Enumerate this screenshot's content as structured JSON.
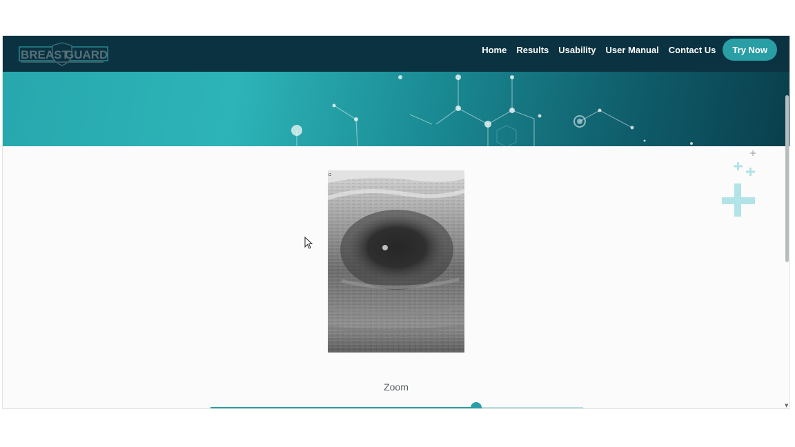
{
  "brand": {
    "logo_text_left": "BREAST",
    "logo_text_right": "GUARD",
    "logo_icon": "shield-logo-icon"
  },
  "nav": {
    "items": [
      {
        "label": "Home"
      },
      {
        "label": "Results"
      },
      {
        "label": "Usability"
      },
      {
        "label": "User Manual"
      },
      {
        "label": "Contact Us"
      }
    ],
    "cta_label": "Try Now"
  },
  "main": {
    "image_icon": "ultrasound-scan-image",
    "zoom_label": "Zoom",
    "zoom_level": 0.713
  },
  "icons": {
    "cursor": "mouse-pointer-icon",
    "decoration": "medical-cross-icon"
  },
  "colors": {
    "navbar": "#0b3240",
    "accent": "#2a9ea5",
    "hero_start": "#27a7ad",
    "hero_end": "#0a3e4c"
  }
}
